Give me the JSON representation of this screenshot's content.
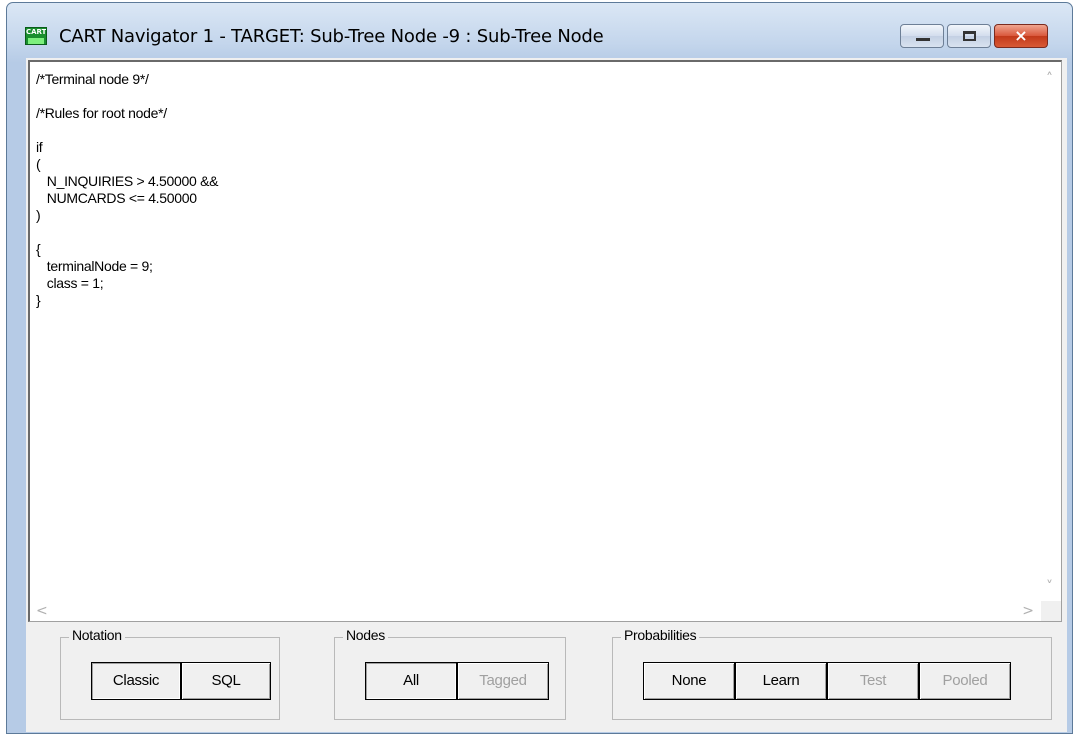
{
  "window": {
    "title": "CART Navigator 1 - TARGET: Sub-Tree Node -9 : Sub-Tree Node",
    "app_icon_text": "CART",
    "controls": {
      "minimize": "minimize-icon",
      "maximize": "maximize-icon",
      "close": "×"
    }
  },
  "code_lines": [
    "/*Terminal node 9*/",
    "",
    "/*Rules for root node*/",
    "",
    "if",
    "(",
    "   N_INQUIRIES > 4.50000 &&",
    "   NUMCARDS <= 4.50000",
    ")",
    "",
    "{",
    "   terminalNode = 9;",
    "   class = 1;",
    "}"
  ],
  "scroll": {
    "up": "˄",
    "down": "˅",
    "left": "<",
    "right": ">"
  },
  "notation": {
    "legend": "Notation",
    "buttons": [
      {
        "label": "Classic",
        "state": "pressed"
      },
      {
        "label": "SQL",
        "state": "normal"
      }
    ]
  },
  "nodes": {
    "legend": "Nodes",
    "buttons": [
      {
        "label": "All",
        "state": "pressed"
      },
      {
        "label": "Tagged",
        "state": "disabled"
      }
    ]
  },
  "probabilities": {
    "legend": "Probabilities",
    "buttons": [
      {
        "label": "None",
        "state": "normal"
      },
      {
        "label": "Learn",
        "state": "normal"
      },
      {
        "label": "Test",
        "state": "disabled"
      },
      {
        "label": "Pooled",
        "state": "disabled"
      }
    ]
  },
  "colors": {
    "title_gradient_top": "#dbe7f5",
    "close_red": "#c2391a",
    "disabled_text": "#a0a0a0"
  }
}
